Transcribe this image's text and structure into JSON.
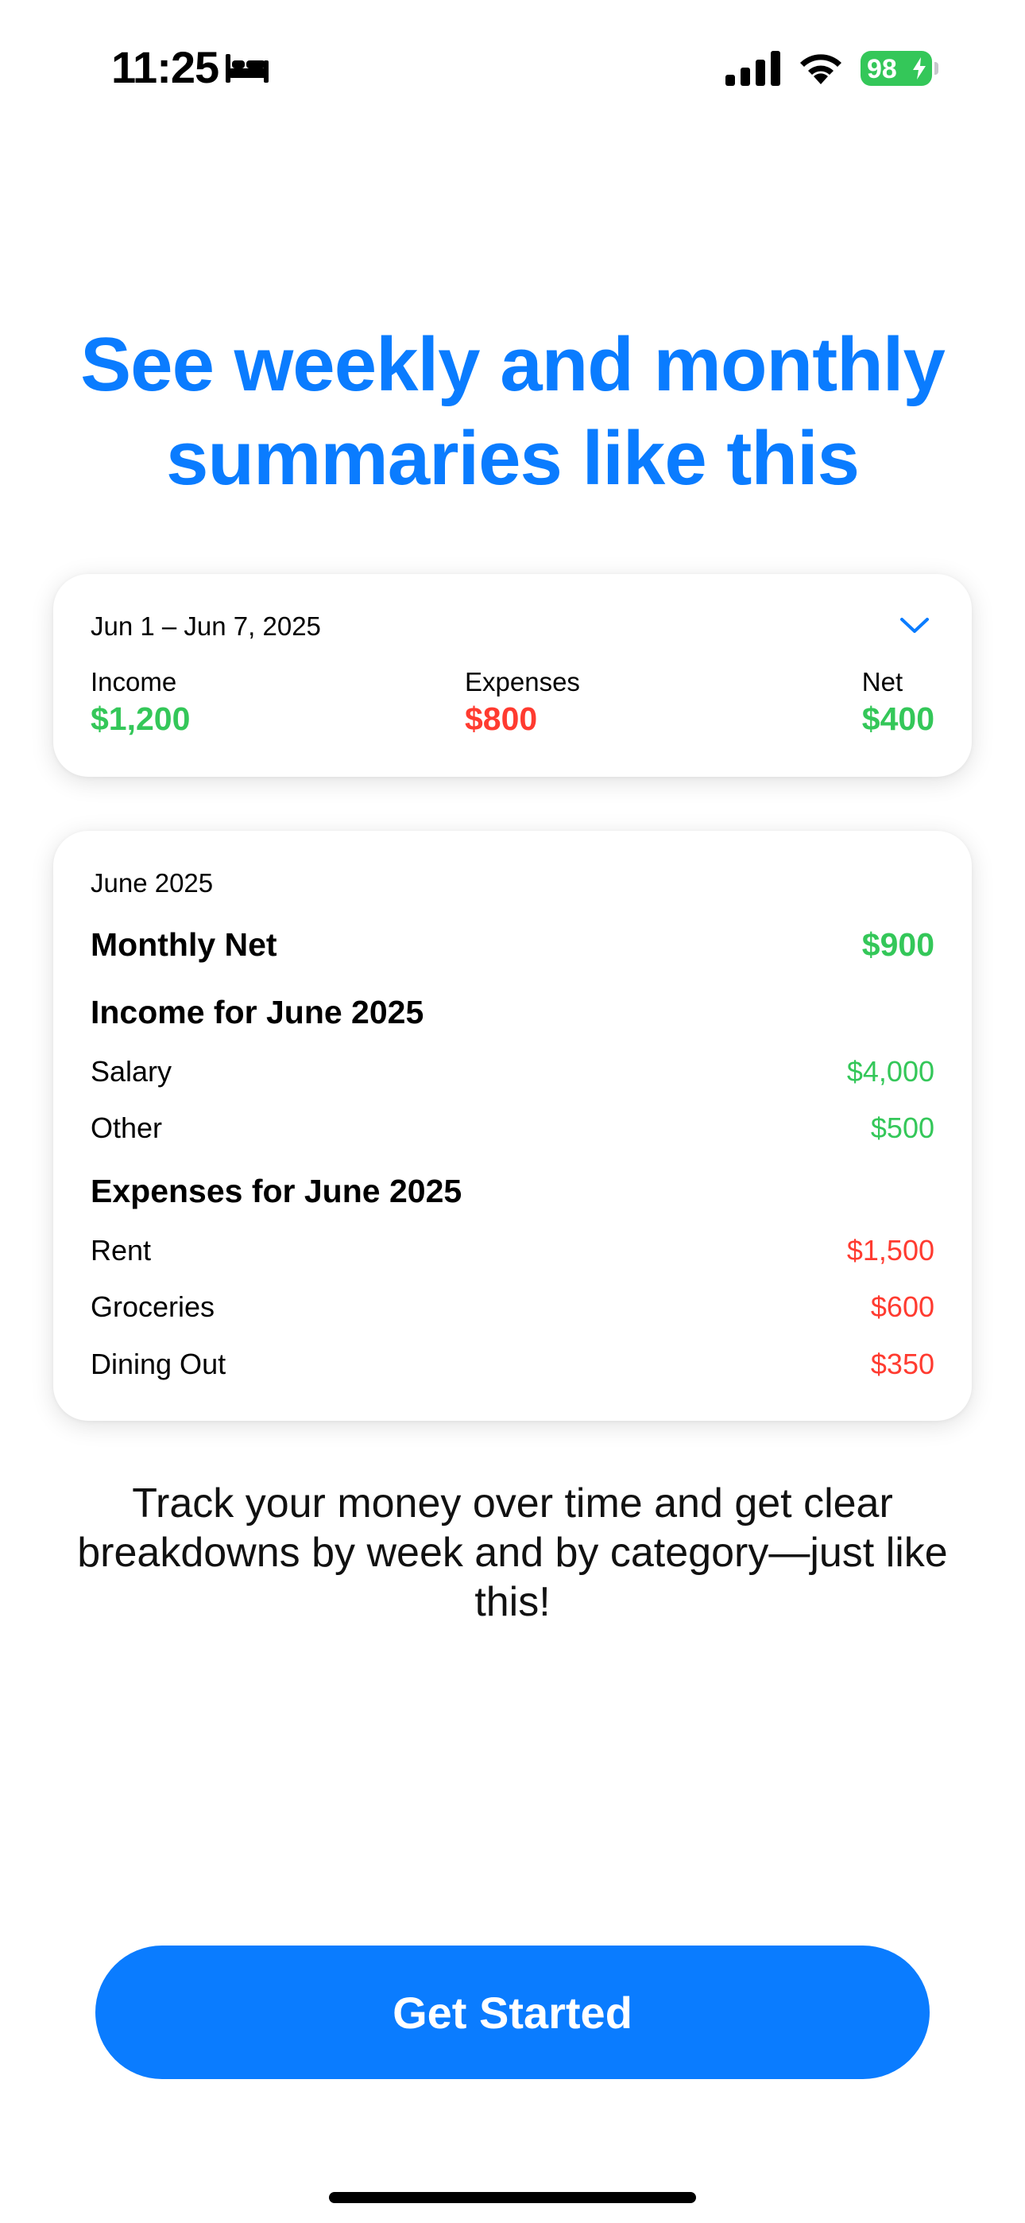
{
  "status_bar": {
    "time": "11:25",
    "battery": "98",
    "battery_color": "#34c759"
  },
  "headline": "See weekly and monthly summaries like this",
  "weekly_card": {
    "range": "Jun 1 – Jun 7, 2025",
    "income_label": "Income",
    "income_value": "$1,200",
    "expenses_label": "Expenses",
    "expenses_value": "$800",
    "net_label": "Net",
    "net_value": "$400"
  },
  "monthly_card": {
    "month": "June 2025",
    "monthly_net_label": "Monthly Net",
    "monthly_net_value": "$900",
    "income_title": "Income for June 2025",
    "income_items": [
      {
        "label": "Salary",
        "value": "$4,000"
      },
      {
        "label": "Other",
        "value": "$500"
      }
    ],
    "expenses_title": "Expenses for June 2025",
    "expense_items": [
      {
        "label": "Rent",
        "value": "$1,500"
      },
      {
        "label": "Groceries",
        "value": "$600"
      },
      {
        "label": "Dining Out",
        "value": "$350"
      }
    ]
  },
  "description": "Track your money over time and get clear breakdowns by week and by category—just like this!",
  "cta_label": "Get Started",
  "colors": {
    "accent": "#0a7cff",
    "positive": "#34c759",
    "negative": "#ff3b30"
  }
}
